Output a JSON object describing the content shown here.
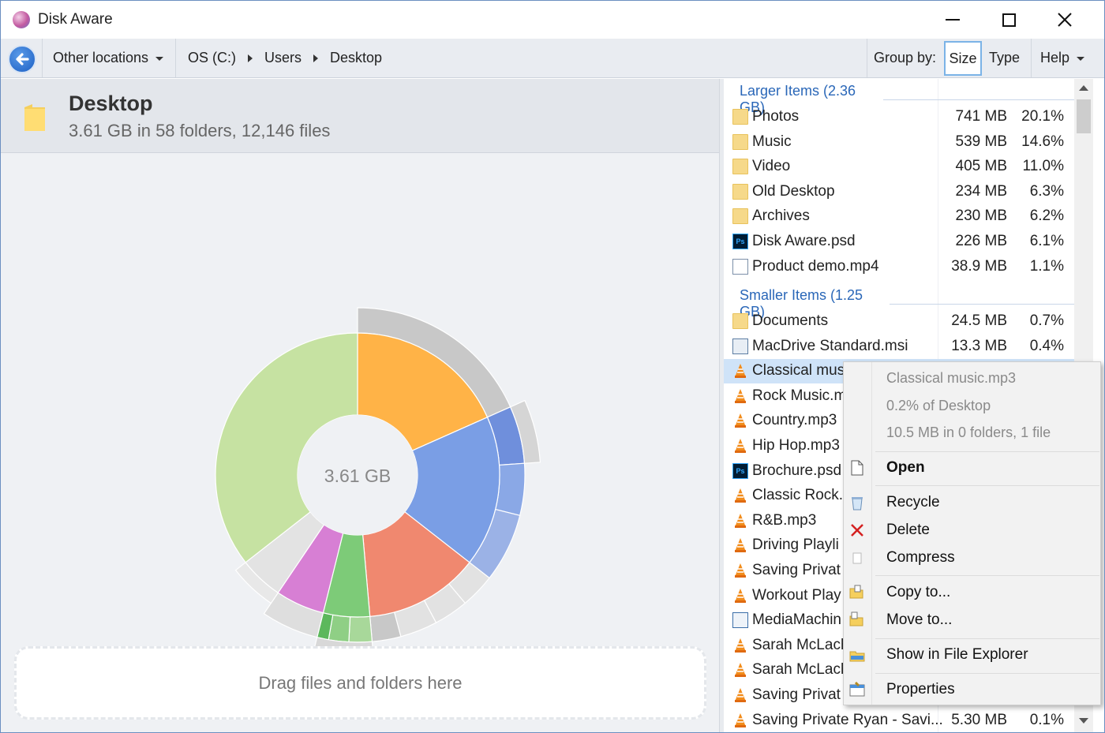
{
  "window": {
    "title": "Disk Aware"
  },
  "toolbar": {
    "other_locations": "Other locations",
    "breadcrumb": [
      "OS (C:)",
      "Users",
      "Desktop"
    ],
    "group_by_label": "Group by:",
    "group_size": "Size",
    "group_type": "Type",
    "help": "Help"
  },
  "header": {
    "title": "Desktop",
    "subtitle": "3.61 GB in 58 folders, 12,146 files"
  },
  "chart": {
    "center_label": "3.61 GB"
  },
  "dropzone": {
    "text": "Drag files and folders here"
  },
  "list": {
    "larger_title": "Larger Items (2.36 GB)",
    "larger": [
      {
        "name": "Photos",
        "size": "741 MB",
        "pct": "20.1%",
        "icon": "folder-icon"
      },
      {
        "name": "Music",
        "size": "539 MB",
        "pct": "14.6%",
        "icon": "folder-icon"
      },
      {
        "name": "Video",
        "size": "405 MB",
        "pct": "11.0%",
        "icon": "folder-icon"
      },
      {
        "name": "Old Desktop",
        "size": "234 MB",
        "pct": "6.3%",
        "icon": "folder-icon"
      },
      {
        "name": "Archives",
        "size": "230 MB",
        "pct": "6.2%",
        "icon": "folder-icon"
      },
      {
        "name": "Disk Aware.psd",
        "size": "226 MB",
        "pct": "6.1%",
        "icon": "psd-icon"
      },
      {
        "name": "Product demo.mp4",
        "size": "38.9 MB",
        "pct": "1.1%",
        "icon": "video-file-icon"
      }
    ],
    "smaller_title": "Smaller Items (1.25 GB)",
    "smaller": [
      {
        "name": "Documents",
        "size": "24.5 MB",
        "pct": "0.7%",
        "icon": "folder-icon"
      },
      {
        "name": "MacDrive Standard.msi",
        "size": "13.3 MB",
        "pct": "0.4%",
        "icon": "msi-icon"
      },
      {
        "name": "Classical mus",
        "size": "",
        "pct": "",
        "icon": "vlc-icon"
      },
      {
        "name": "Rock Music.m",
        "size": "",
        "pct": "",
        "icon": "vlc-icon"
      },
      {
        "name": "Country.mp3",
        "size": "",
        "pct": "",
        "icon": "vlc-icon"
      },
      {
        "name": "Hip Hop.mp3",
        "size": "",
        "pct": "",
        "icon": "vlc-icon"
      },
      {
        "name": "Brochure.psd",
        "size": "",
        "pct": "",
        "icon": "psd-icon"
      },
      {
        "name": "Classic Rock.",
        "size": "",
        "pct": "",
        "icon": "vlc-icon"
      },
      {
        "name": "R&B.mp3",
        "size": "",
        "pct": "",
        "icon": "vlc-icon"
      },
      {
        "name": "Driving Playli",
        "size": "",
        "pct": "",
        "icon": "vlc-icon"
      },
      {
        "name": "Saving Privat",
        "size": "",
        "pct": "",
        "icon": "vlc-icon"
      },
      {
        "name": "Workout Play",
        "size": "",
        "pct": "",
        "icon": "vlc-icon"
      },
      {
        "name": "MediaMachin",
        "size": "",
        "pct": "",
        "icon": "app-icon"
      },
      {
        "name": "Sarah McLach",
        "size": "",
        "pct": "",
        "icon": "vlc-icon"
      },
      {
        "name": "Sarah McLach",
        "size": "",
        "pct": "",
        "icon": "vlc-icon"
      },
      {
        "name": "Saving Privat",
        "size": "",
        "pct": "",
        "icon": "vlc-icon"
      },
      {
        "name": "Saving Private Ryan - Savi...",
        "size": "5.30 MB",
        "pct": "0.1%",
        "icon": "vlc-icon"
      }
    ]
  },
  "context_menu": {
    "file_name": "Classical music.mp3",
    "share": "0.2% of Desktop",
    "detail": "10.5 MB in 0 folders, 1 file",
    "open": "Open",
    "recycle": "Recycle",
    "delete": "Delete",
    "compress": "Compress",
    "copy_to": "Copy to...",
    "move_to": "Move to...",
    "show_explorer": "Show in File Explorer",
    "properties": "Properties"
  },
  "colors": {
    "accent": "#2a67b8",
    "selection": "#cfe3f8",
    "orange": "#ffb347",
    "blue": "#7a9ee5",
    "salmon": "#f0886f",
    "green": "#7dcb78",
    "magenta": "#d77fd4",
    "lightgreen": "#c6e2a2",
    "grey": "#c8c8c8"
  }
}
